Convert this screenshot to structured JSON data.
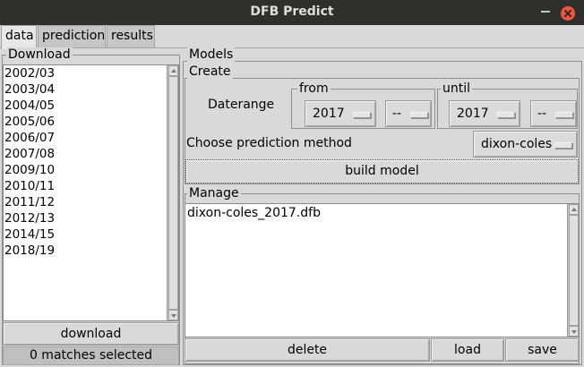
{
  "window": {
    "title": "DFB Predict"
  },
  "tabs": [
    {
      "label": "data"
    },
    {
      "label": "prediction"
    },
    {
      "label": "results"
    }
  ],
  "download": {
    "group_label": "Download",
    "seasons": [
      "2002/03",
      "2003/04",
      "2004/05",
      "2005/06",
      "2006/07",
      "2007/08",
      "2009/10",
      "2010/11",
      "2011/12",
      "2012/13",
      "2014/15",
      "2018/19"
    ],
    "download_label": "download",
    "status": "0 matches selected"
  },
  "models": {
    "group_label": "Models",
    "create": {
      "group_label": "Create",
      "daterange_label": "Daterange",
      "from_label": "from",
      "until_label": "until",
      "from_year": "2017",
      "from_sub": "--",
      "until_year": "2017",
      "until_sub": "--",
      "method_label": "Choose prediction method",
      "method_value": "dixon-coles",
      "build_label": "build model"
    },
    "manage": {
      "group_label": "Manage",
      "files": [
        "dixon-coles_2017.dfb"
      ],
      "delete_label": "delete",
      "load_label": "load",
      "save_label": "save"
    }
  },
  "icons": {
    "minimize": "minimize-icon",
    "close": "close-icon",
    "dropdown": "dropdown-indicator-icon",
    "scroll_up": "arrow-up-icon",
    "scroll_down": "arrow-down-icon"
  }
}
